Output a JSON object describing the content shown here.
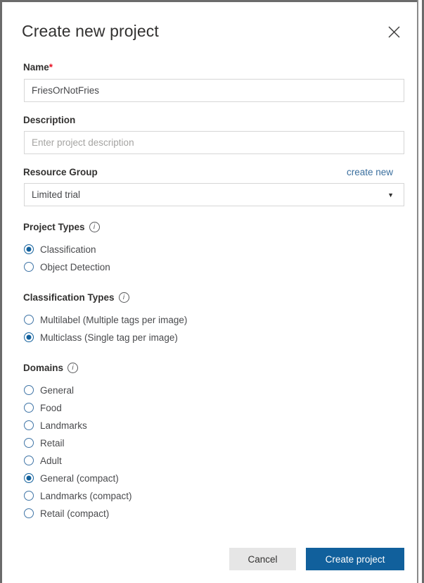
{
  "dialog": {
    "title": "Create new project",
    "close_icon": "close-icon"
  },
  "name_field": {
    "label": "Name",
    "required_mark": "*",
    "value": "FriesOrNotFries"
  },
  "description_field": {
    "label": "Description",
    "value": "",
    "placeholder": "Enter project description"
  },
  "resource_group": {
    "label": "Resource Group",
    "create_new_link": "create new",
    "selected": "Limited trial",
    "arrow": "▼"
  },
  "project_types": {
    "heading": "Project Types",
    "info": "i",
    "options": [
      {
        "label": "Classification",
        "selected": true
      },
      {
        "label": "Object Detection",
        "selected": false
      }
    ]
  },
  "classification_types": {
    "heading": "Classification Types",
    "info": "i",
    "options": [
      {
        "label": "Multilabel (Multiple tags per image)",
        "selected": false
      },
      {
        "label": "Multiclass (Single tag per image)",
        "selected": true
      }
    ]
  },
  "domains": {
    "heading": "Domains",
    "info": "i",
    "options": [
      {
        "label": "General",
        "selected": false
      },
      {
        "label": "Food",
        "selected": false
      },
      {
        "label": "Landmarks",
        "selected": false
      },
      {
        "label": "Retail",
        "selected": false
      },
      {
        "label": "Adult",
        "selected": false
      },
      {
        "label": "General (compact)",
        "selected": true
      },
      {
        "label": "Landmarks (compact)",
        "selected": false
      },
      {
        "label": "Retail (compact)",
        "selected": false
      }
    ]
  },
  "footer": {
    "cancel_label": "Cancel",
    "create_label": "Create project"
  },
  "colors": {
    "primary": "#11609c",
    "link": "#3b6f9e",
    "required": "#e81123",
    "text": "#323130"
  }
}
